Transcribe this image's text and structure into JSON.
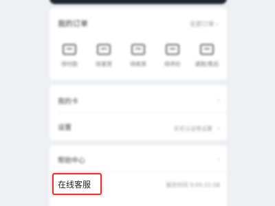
{
  "orders": {
    "title": "我的订单",
    "more_label": "全部订单 ›",
    "items": [
      {
        "label": "待付款",
        "icon": "wallet-icon"
      },
      {
        "label": "待发货",
        "icon": "package-icon"
      },
      {
        "label": "待收货",
        "icon": "truck-icon"
      },
      {
        "label": "待评价",
        "icon": "comment-icon"
      },
      {
        "label": "退款/售后",
        "icon": "refund-icon"
      }
    ]
  },
  "menu": {
    "item1": {
      "label": "我的卡"
    },
    "item2": {
      "label": "设置",
      "value": "实名认证等设置"
    },
    "item3": {
      "label": "帮助中心"
    }
  },
  "customer_service": {
    "label": "在线客服",
    "hint": "服务时间 9:00-22:00"
  }
}
